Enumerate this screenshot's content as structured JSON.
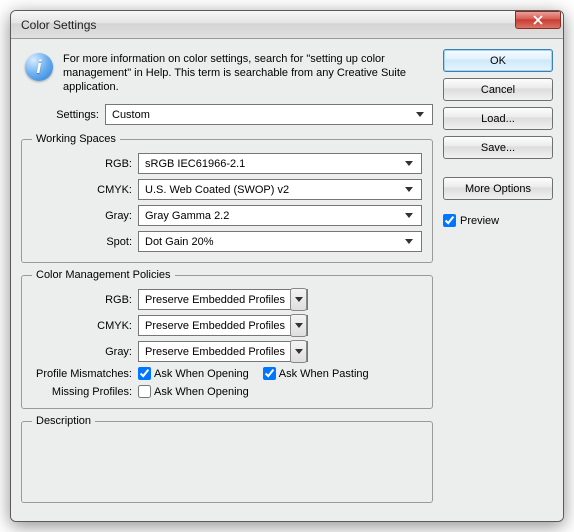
{
  "window": {
    "title": "Color Settings"
  },
  "info": {
    "text": "For more information on color settings, search for \"setting up color management\" in Help. This term is searchable from any Creative Suite application."
  },
  "settings": {
    "label": "Settings:",
    "value": "Custom"
  },
  "working_spaces": {
    "legend": "Working Spaces",
    "rgb_label": "RGB:",
    "rgb_value": "sRGB IEC61966-2.1",
    "cmyk_label": "CMYK:",
    "cmyk_value": "U.S. Web Coated (SWOP) v2",
    "gray_label": "Gray:",
    "gray_value": "Gray Gamma 2.2",
    "spot_label": "Spot:",
    "spot_value": "Dot Gain 20%"
  },
  "policies": {
    "legend": "Color Management Policies",
    "rgb_label": "RGB:",
    "rgb_value": "Preserve Embedded Profiles",
    "cmyk_label": "CMYK:",
    "cmyk_value": "Preserve Embedded Profiles",
    "gray_label": "Gray:",
    "gray_value": "Preserve Embedded Profiles",
    "mismatch_label": "Profile Mismatches:",
    "mismatch_open": "Ask When Opening",
    "mismatch_paste": "Ask When Pasting",
    "missing_label": "Missing Profiles:",
    "missing_open": "Ask When Opening"
  },
  "description": {
    "legend": "Description"
  },
  "buttons": {
    "ok": "OK",
    "cancel": "Cancel",
    "load": "Load...",
    "save": "Save...",
    "more_options": "More Options",
    "preview": "Preview"
  }
}
